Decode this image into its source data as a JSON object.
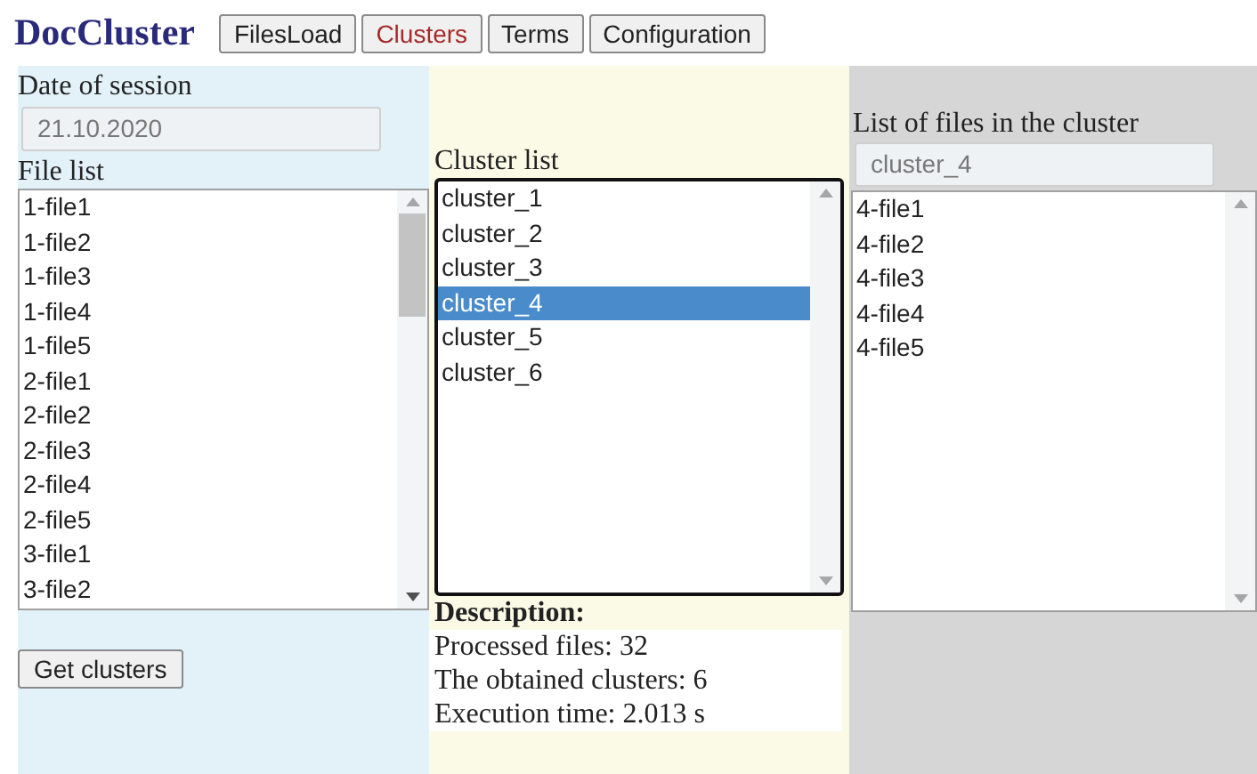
{
  "app_title": "DocCluster",
  "tabs": [
    {
      "label": "FilesLoad",
      "selected": false
    },
    {
      "label": "Clusters",
      "selected": true
    },
    {
      "label": "Terms",
      "selected": false
    },
    {
      "label": "Configuration",
      "selected": false
    }
  ],
  "session": {
    "label": "Date of session",
    "value": "21.10.2020"
  },
  "file_list": {
    "label": "File list",
    "items": [
      "1-file1",
      "1-file2",
      "1-file3",
      "1-file4",
      "1-file5",
      "2-file1",
      "2-file2",
      "2-file3",
      "2-file4",
      "2-file5",
      "3-file1",
      "3-file2"
    ]
  },
  "get_clusters_button": "Get clusters",
  "cluster_list": {
    "label": "Cluster list",
    "items": [
      {
        "label": "cluster_1",
        "selected": false
      },
      {
        "label": "cluster_2",
        "selected": false
      },
      {
        "label": "cluster_3",
        "selected": false
      },
      {
        "label": "cluster_4",
        "selected": true
      },
      {
        "label": "cluster_5",
        "selected": false
      },
      {
        "label": "cluster_6",
        "selected": false
      }
    ]
  },
  "description": {
    "heading": "Description:",
    "lines": [
      "Processed files: 32",
      "The obtained clusters: 6",
      "Execution time: 2.013 s"
    ]
  },
  "cluster_files": {
    "label": "List of files in the cluster",
    "value": "cluster_4",
    "items": [
      "4-file1",
      "4-file2",
      "4-file3",
      "4-file4",
      "4-file5"
    ]
  }
}
